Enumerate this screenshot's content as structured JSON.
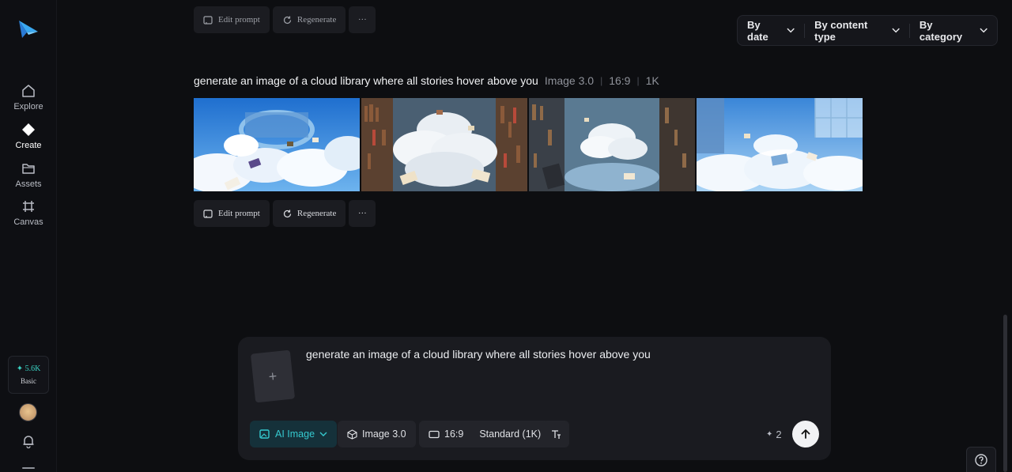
{
  "sidebar": {
    "items": [
      {
        "label": "Explore",
        "icon": "home-icon"
      },
      {
        "label": "Create",
        "icon": "diamond-icon"
      },
      {
        "label": "Assets",
        "icon": "folder-icon"
      },
      {
        "label": "Canvas",
        "icon": "canvas-icon"
      }
    ],
    "active": "Create",
    "credits_amount": "5.6K",
    "credits_plan": "Basic",
    "accent_color": "#3ad3c4"
  },
  "toolbar": {
    "edit_prompt": "Edit prompt",
    "regenerate": "Regenerate",
    "more": "···"
  },
  "filters": [
    {
      "label": "By date"
    },
    {
      "label": "By content type"
    },
    {
      "label": "By category"
    }
  ],
  "generation": {
    "prompt": "generate an image of a cloud library where all stories hover above you",
    "model": "Image 3.0",
    "ratio": "16:9",
    "resolution": "1K"
  },
  "composer": {
    "text": "generate an image of a cloud library where all stories hover above you",
    "mode_label": "AI Image",
    "model_label": "Image 3.0",
    "ratio_label": "16:9",
    "quality_label": "Standard (1K)",
    "cost": "2"
  }
}
